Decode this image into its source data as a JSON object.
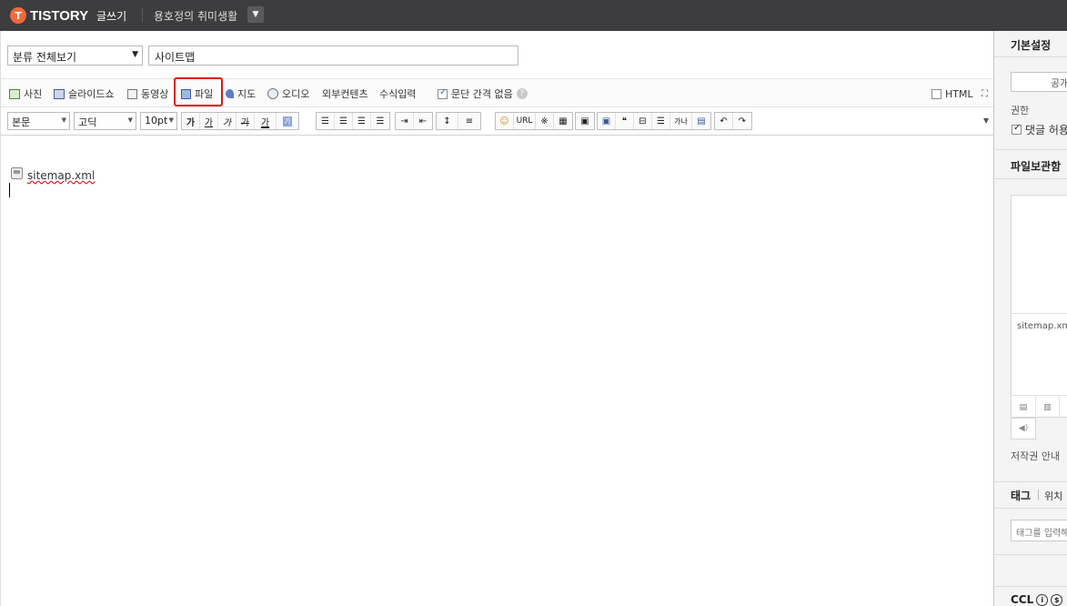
{
  "topbar": {
    "logo_mark": "T",
    "logo_text": "TISTORY",
    "write_label": "글쓰기",
    "blog_name": "용호정의 취미생활",
    "blog_dropdown_icon": "chevron-down-icon"
  },
  "editor": {
    "category": "분류 전체보기",
    "title": "사이트맵",
    "attach": [
      {
        "id": "photo",
        "label": "사진",
        "icon": "photo-icon"
      },
      {
        "id": "slideshow",
        "label": "슬라이드쇼",
        "icon": "slideshow-icon"
      },
      {
        "id": "video",
        "label": "동영상",
        "icon": "video-icon"
      },
      {
        "id": "file",
        "label": "파일",
        "icon": "file-icon",
        "highlighted": true
      },
      {
        "id": "map",
        "label": "지도",
        "icon": "map-icon"
      },
      {
        "id": "audio",
        "label": "오디오",
        "icon": "audio-icon"
      },
      {
        "id": "external",
        "label": "외부컨텐츠"
      },
      {
        "id": "formula",
        "label": "수식입력"
      }
    ],
    "paragraph_spacing_label": "문단 간격 없음",
    "paragraph_spacing_checked": true,
    "html_label": "HTML",
    "html_checked": false,
    "format": {
      "style": "본문",
      "font": "고딕",
      "size": "10pt",
      "text_buttons": [
        "가",
        "가",
        "가",
        "가",
        "가"
      ],
      "highlight_label": "가",
      "url_label": "URL",
      "char_count_label": "가나"
    },
    "content": {
      "file_name": "sitemap.xml"
    }
  },
  "panel": {
    "basic_settings": "기본설정",
    "publish": "공개",
    "permission_label": "권한",
    "allow_comments": "댓글 허용",
    "allow_comments_checked": true,
    "file_storage": "파일보관함",
    "stored_file": "sitemap.xml",
    "copyright_guide": "저작권 안내",
    "tag_tab": "태그",
    "location_tab": "위치",
    "tag_placeholder": "태그를 입력해",
    "ccl": "CCL"
  },
  "colors": {
    "topbar_bg": "#3d3d3f",
    "logo_accent": "#f2683a",
    "highlight_border": "#e0161c"
  }
}
